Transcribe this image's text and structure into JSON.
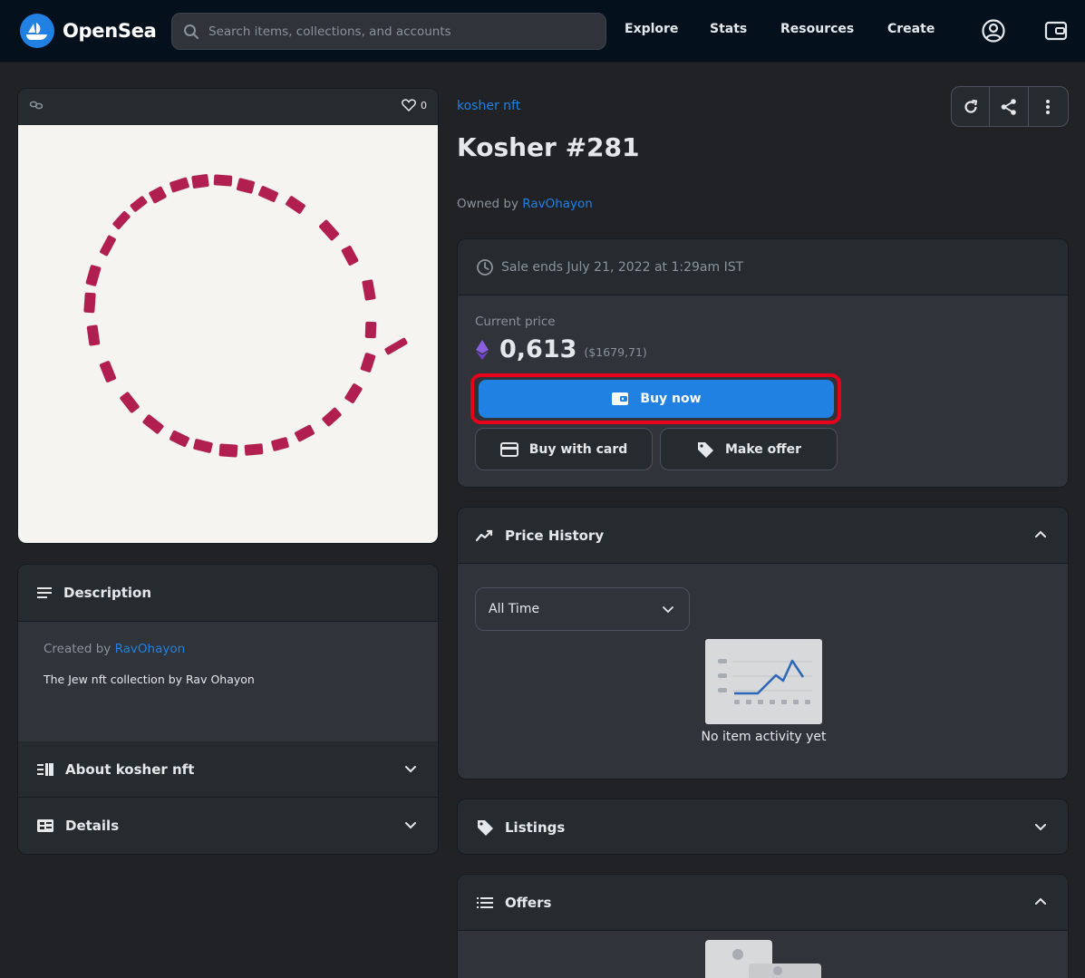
{
  "nav": {
    "brand": "OpenSea",
    "search_placeholder": "Search items, collections, and accounts",
    "links": [
      "Explore",
      "Stats",
      "Resources",
      "Create"
    ],
    "icons": [
      "account-icon",
      "wallet-icon"
    ]
  },
  "image_card": {
    "chain_icon": "link-icon",
    "like_count": "0"
  },
  "item": {
    "collection": "kosher nft",
    "title": "Kosher #281",
    "owned_by_label": "Owned by",
    "owner": "RavOhayon"
  },
  "actions": [
    "refresh-icon",
    "share-icon",
    "more-icon"
  ],
  "sale": {
    "ends_text": "Sale ends July 21, 2022 at 1:29am IST",
    "current_price_label": "Current price",
    "price": "0,613",
    "price_usd": "($1679,71)",
    "buy_now": "Buy now",
    "buy_with_card": "Buy with card",
    "make_offer": "Make offer",
    "accent": "#2081e2",
    "highlight_color": "#e8001a"
  },
  "description": {
    "title": "Description",
    "created_by_label": "Created by",
    "creator": "RavOhayon",
    "text": "The Jew nft collection by Rav Ohayon"
  },
  "about": {
    "title": "About kosher nft"
  },
  "details": {
    "title": "Details"
  },
  "price_history": {
    "title": "Price History",
    "filter": "All Time",
    "empty_text": "No item activity yet"
  },
  "listings": {
    "title": "Listings"
  },
  "offers": {
    "title": "Offers"
  }
}
